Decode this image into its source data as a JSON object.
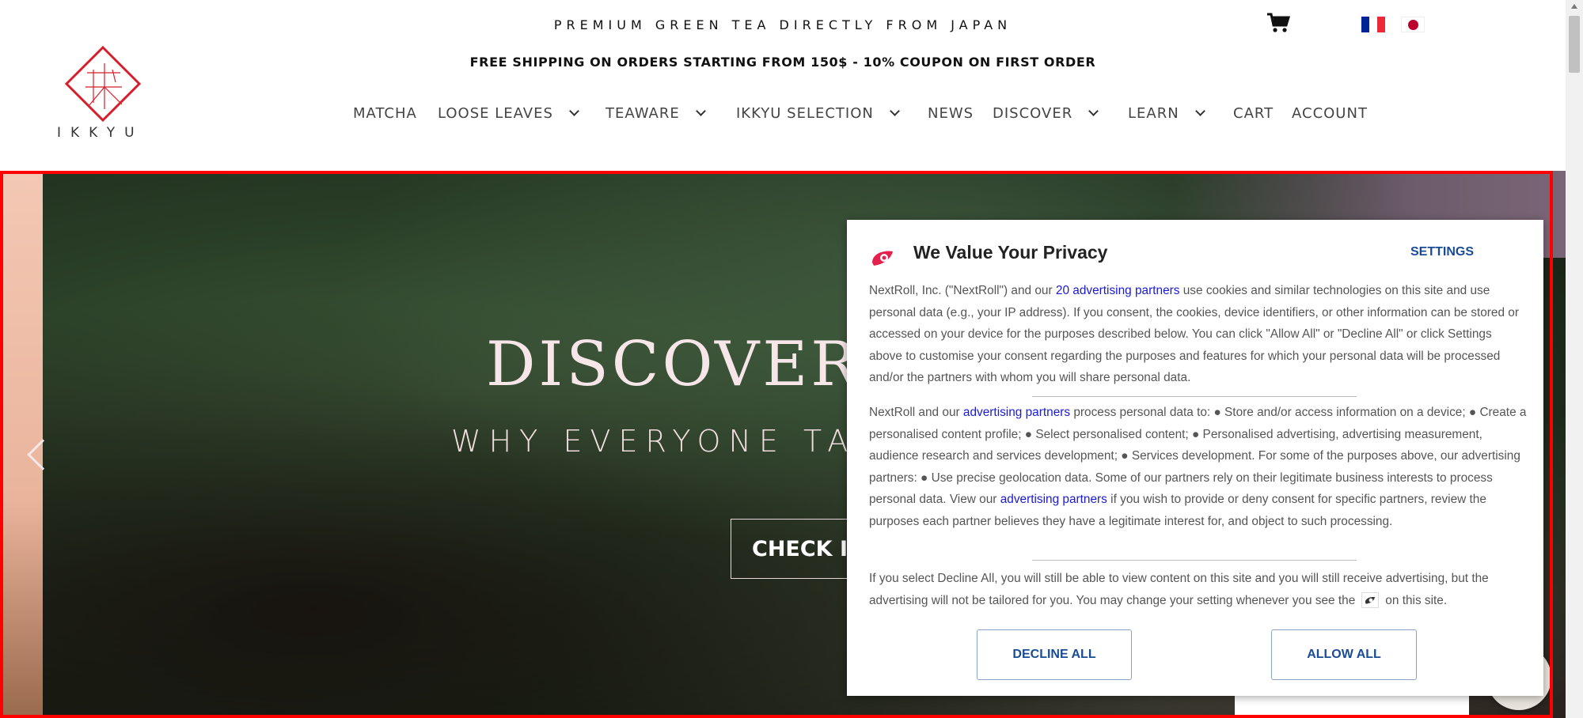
{
  "header": {
    "tagline": "PREMIUM GREEN TEA DIRECTLY FROM JAPAN",
    "shipping": "FREE SHIPPING ON ORDERS STARTING FROM 150$ - 10% COUPON ON FIRST ORDER",
    "logo_text": "IKKYU",
    "cart_icon": "cart-icon",
    "flags": [
      "flag-fr",
      "flag-jp"
    ]
  },
  "nav": {
    "items": [
      {
        "label": "MATCHA",
        "dropdown": false
      },
      {
        "label": "LOOSE LEAVES",
        "dropdown": true
      },
      {
        "label": "TEAWARE",
        "dropdown": true
      },
      {
        "label": "IKKYU SELECTION",
        "dropdown": true
      },
      {
        "label": "NEWS",
        "dropdown": false
      },
      {
        "label": "DISCOVER",
        "dropdown": true
      },
      {
        "label": "LEARN",
        "dropdown": true
      },
      {
        "label": "CART",
        "dropdown": false
      },
      {
        "label": "ACCOUNT",
        "dropdown": false
      }
    ]
  },
  "hero": {
    "title": "DISCOVER W",
    "subtitle": "WHY EVERYONE TA",
    "cta": "CHECK IT",
    "prev_icon": "chevron-left-icon"
  },
  "consent": {
    "title": "We Value Your Privacy",
    "settings": "SETTINGS",
    "p1_a": "NextRoll, Inc. (\"NextRoll\") and our ",
    "p1_link": "20 advertising partners",
    "p1_b": " use cookies and similar technologies on this site and use personal data (e.g., your IP address). If you consent, the cookies, device identifiers, or other information can be stored or accessed on your device for the purposes described below. You can click \"Allow All\" or \"Decline All\" or click Settings above to customise your consent regarding the purposes and features for which your personal data will be processed and/or the partners with whom you will share personal data.",
    "p2_a": "NextRoll and our ",
    "p2_link1": "advertising partners",
    "p2_b": " process personal data to: ● Store and/or access information on a device; ● Create a personalised content profile; ● Select personalised content; ● Personalised advertising, advertising measurement, audience research and services development; ● Services development. For some of the purposes above, our advertising partners: ● Use precise geolocation data. Some of our partners rely on their legitimate business interests to process personal data. View our ",
    "p2_link2": "advertising partners",
    "p2_c": " if you wish to provide or deny consent for specific partners, review the purposes each partner believes they have a legitimate interest for, and object to such processing.",
    "p3_a": "If you select Decline All, you will still be able to view content on this site and you will still receive advertising, but the advertising will not be tailored for you. You may change your setting whenever you see the",
    "p3_b": "on this site.",
    "decline": "DECLINE ALL",
    "allow": "ALLOW ALL",
    "brand_color": "#e6204d",
    "link_color": "#1a1ad4",
    "button_color": "#1a4c96"
  }
}
